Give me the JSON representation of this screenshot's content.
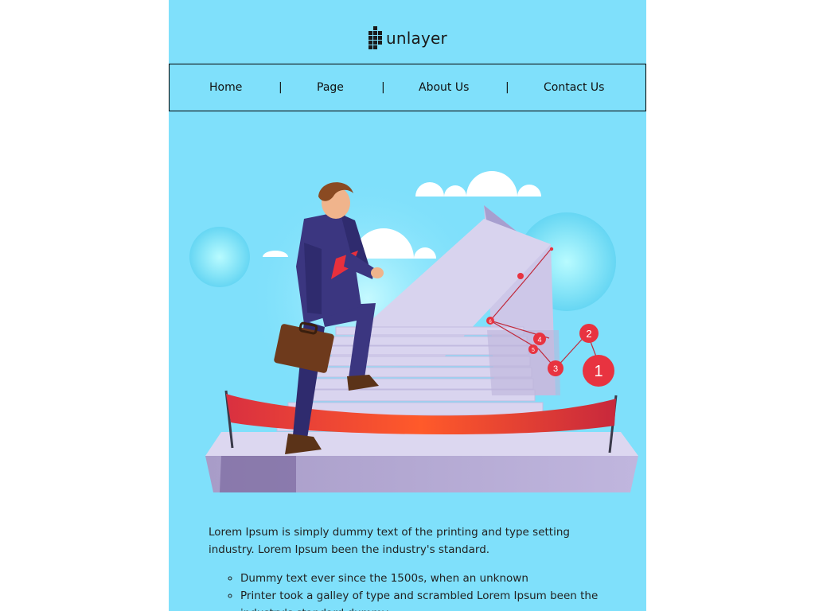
{
  "brand": {
    "logo_text": "unlayer",
    "logo_icon": "grid-dots-icon"
  },
  "nav": {
    "items": [
      "Home",
      "Page",
      "About Us",
      "Contact Us"
    ],
    "separator": "|"
  },
  "hero": {
    "illustration": "businessman-climbing-stairs",
    "markers": [
      "1",
      "2",
      "3",
      "4",
      "5",
      "6"
    ]
  },
  "content": {
    "paragraph": "Lorem Ipsum is simply dummy text of the printing and type setting industry. Lorem Ipsum been the industry's standard.",
    "bullets": [
      "Dummy text ever since the 1500s, when an unknown",
      "Printer took a galley of type and scrambled Lorem Ipsum been the industry's standard dummy"
    ]
  },
  "colors": {
    "background": "#7fe0fb",
    "page": "#ffffff",
    "ribbon": "#e83d3d",
    "stairs": "#b8b0d8",
    "suit": "#3b3680",
    "marker": "#e83340"
  }
}
